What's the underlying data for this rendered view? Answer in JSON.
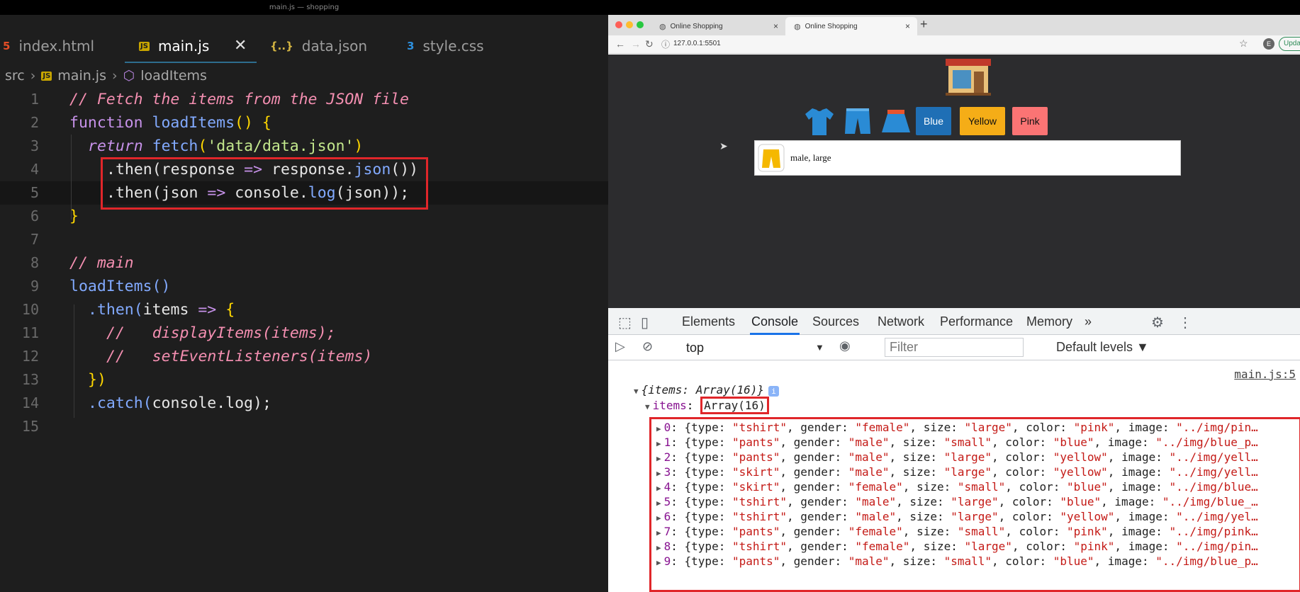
{
  "editor": {
    "window_title": "main.js — shopping",
    "tabs": [
      {
        "icon": "html-file-icon",
        "label": "index.html"
      },
      {
        "icon": "js-file-icon",
        "label": "main.js"
      },
      {
        "icon": "json-file-icon",
        "label": "data.json"
      },
      {
        "icon": "css-file-icon",
        "label": "style.css"
      }
    ],
    "breadcrumb": {
      "folder": "src",
      "file": "main.js",
      "symbol": "loadItems"
    },
    "line_numbers": [
      "1",
      "2",
      "3",
      "4",
      "5",
      "6",
      "7",
      "8",
      "9",
      "10",
      "11",
      "12",
      "13",
      "14",
      "15"
    ],
    "code": {
      "l1": "// Fetch the items from the JSON file",
      "l2_kw": "function",
      "l2_fn": "loadItems",
      "l2_rest": "() {",
      "l3_kw": "return",
      "l3_fn": "fetch",
      "l3_str": "'data/data.json'",
      "l4_a": ".then(",
      "l4_b": "response",
      "l4_c": " => ",
      "l4_d": "response.",
      "l4_e": "json",
      "l4_f": "())",
      "l5_a": ".then(",
      "l5_b": "json",
      "l5_c": " => ",
      "l5_d": "console.",
      "l5_e": "log",
      "l5_f": "(json));",
      "l6": "}",
      "l8": "// main",
      "l9": "loadItems()",
      "l10_a": ".then(",
      "l10_b": "items",
      "l10_c": " => ",
      "l10_d": "{",
      "l11": "//   displayItems(items);",
      "l12": "//   setEventListeners(items)",
      "l13": "})",
      "l14_a": ".catch(",
      "l14_b": "console.log",
      "l14_c": ");"
    }
  },
  "browser": {
    "tabs": [
      {
        "label": "Online Shopping"
      },
      {
        "label": "Online Shopping"
      }
    ],
    "url": "127.0.0.1:5501",
    "update_label": "Upda",
    "profile_initial": "E",
    "buttons": [
      {
        "label": "Blue",
        "color": "#1f6fb5"
      },
      {
        "label": "Yellow",
        "color": "#f5ad17"
      },
      {
        "label": "Pink",
        "color": "#fb7474"
      }
    ],
    "item_text": "male, large"
  },
  "devtools": {
    "tabs": [
      "Elements",
      "Console",
      "Sources",
      "Network",
      "Performance",
      "Memory"
    ],
    "context": "top",
    "filter_placeholder": "Filter",
    "levels": "Default levels ▼",
    "source_link": "main.js:5",
    "object_summary": "{items: Array(16)}",
    "items_key": "items",
    "items_value": "Array(16)",
    "rows": [
      {
        "i": "0",
        "type": "\"tshirt\"",
        "gender": "\"female\"",
        "size": "\"large\"",
        "color": "\"pink\"",
        "image": "\"../img/pin…"
      },
      {
        "i": "1",
        "type": "\"pants\"",
        "gender": "\"male\"",
        "size": "\"small\"",
        "color": "\"blue\"",
        "image": "\"../img/blue_p…"
      },
      {
        "i": "2",
        "type": "\"pants\"",
        "gender": "\"male\"",
        "size": "\"large\"",
        "color": "\"yellow\"",
        "image": "\"../img/yell…"
      },
      {
        "i": "3",
        "type": "\"skirt\"",
        "gender": "\"male\"",
        "size": "\"large\"",
        "color": "\"yellow\"",
        "image": "\"../img/yell…"
      },
      {
        "i": "4",
        "type": "\"skirt\"",
        "gender": "\"female\"",
        "size": "\"small\"",
        "color": "\"blue\"",
        "image": "\"../img/blue…"
      },
      {
        "i": "5",
        "type": "\"tshirt\"",
        "gender": "\"male\"",
        "size": "\"large\"",
        "color": "\"blue\"",
        "image": "\"../img/blue_…"
      },
      {
        "i": "6",
        "type": "\"tshirt\"",
        "gender": "\"male\"",
        "size": "\"large\"",
        "color": "\"yellow\"",
        "image": "\"../img/yel…"
      },
      {
        "i": "7",
        "type": "\"pants\"",
        "gender": "\"female\"",
        "size": "\"small\"",
        "color": "\"pink\"",
        "image": "\"../img/pink…"
      },
      {
        "i": "8",
        "type": "\"tshirt\"",
        "gender": "\"female\"",
        "size": "\"large\"",
        "color": "\"pink\"",
        "image": "\"../img/pin…"
      },
      {
        "i": "9",
        "type": "\"pants\"",
        "gender": "\"male\"",
        "size": "\"small\"",
        "color": "\"blue\"",
        "image": "\"../img/blue_p…"
      }
    ]
  }
}
